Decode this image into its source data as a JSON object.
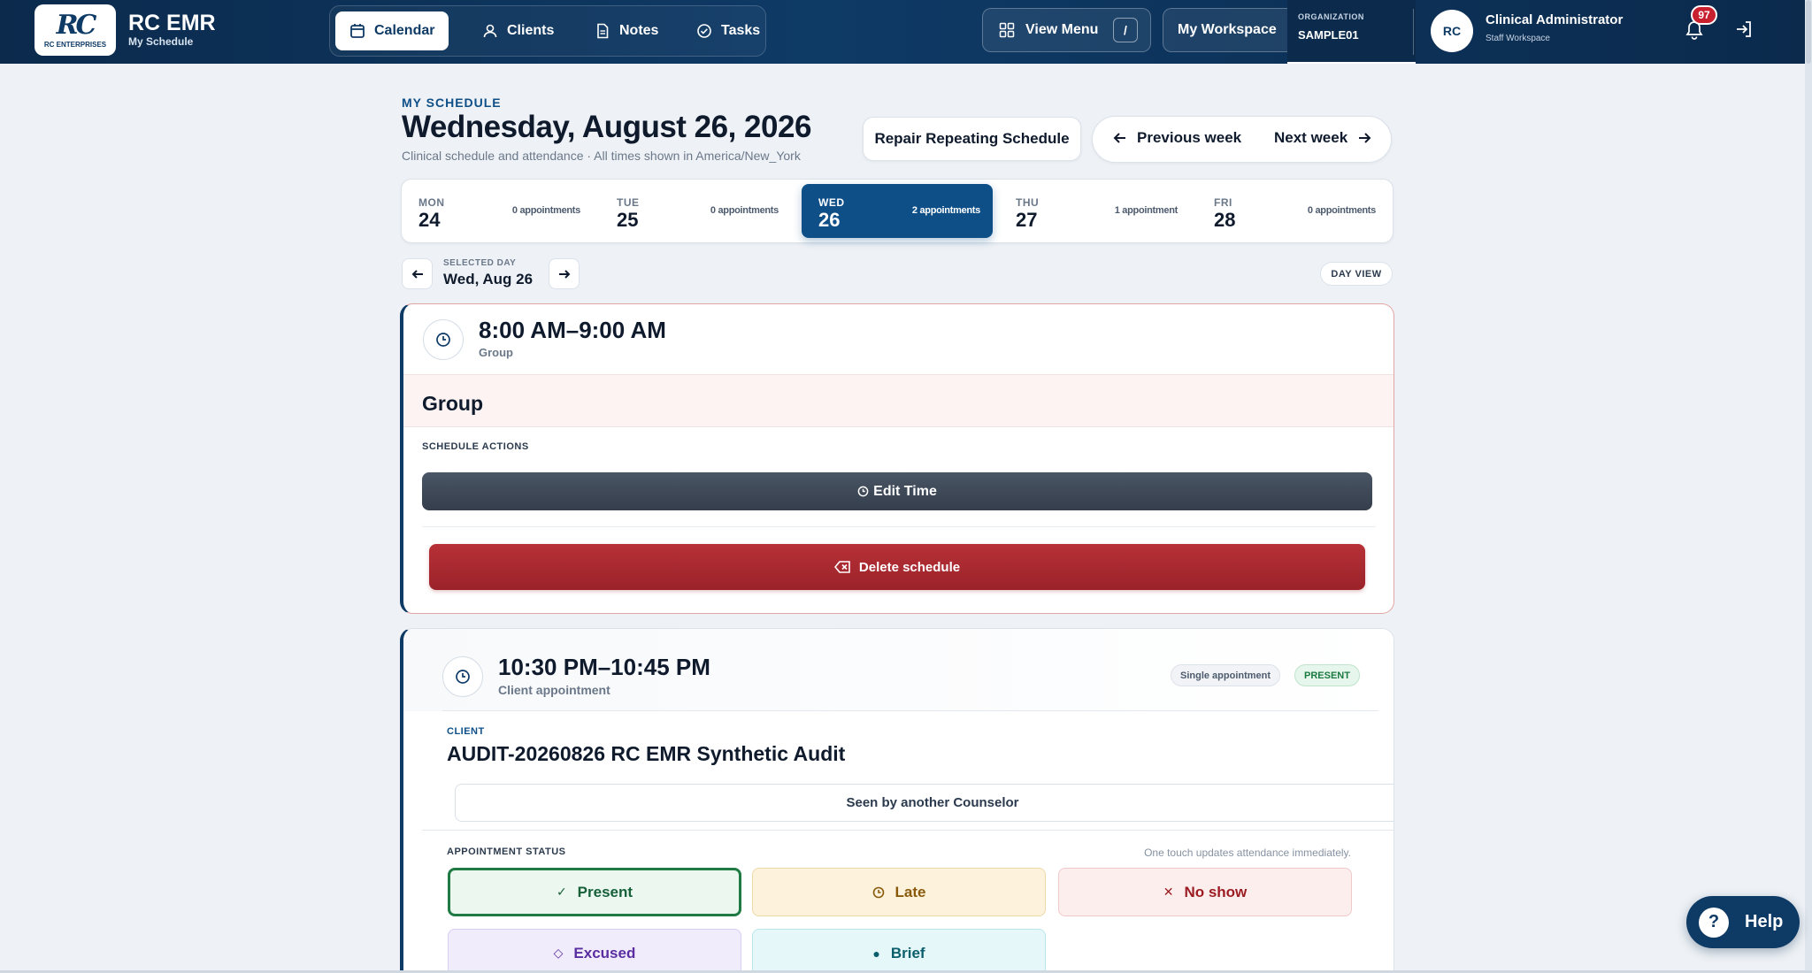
{
  "app": {
    "logo_mark": "RC",
    "logo_text": "RC ENTERPRISES",
    "title": "RC EMR",
    "subtitle": "My Schedule"
  },
  "nav": {
    "items": [
      {
        "label": "Calendar",
        "icon": "calendar-icon",
        "active": true
      },
      {
        "label": "Clients",
        "icon": "user-icon"
      },
      {
        "label": "Notes",
        "icon": "document-icon"
      },
      {
        "label": "Tasks",
        "icon": "check-circle-icon"
      }
    ]
  },
  "header": {
    "view_menu_label": "View Menu",
    "view_menu_shortcut": "/",
    "workspace_label": "My Workspace",
    "org_label": "ORGANIZATION",
    "org_value": "SAMPLE01",
    "avatar_initials": "RC",
    "user_name": "Clinical Administrator",
    "user_role": "Staff Workspace",
    "notification_count": "97"
  },
  "page": {
    "eyebrow": "MY SCHEDULE",
    "title": "Wednesday, August 26, 2026",
    "subtitle": "Clinical schedule and attendance · All times shown in America/New_York",
    "repair_label": "Repair Repeating Schedule",
    "prev_week_label": "Previous week",
    "next_week_label": "Next week"
  },
  "week": {
    "days": [
      {
        "name": "MON",
        "num": "24",
        "count": "0 appointments",
        "active": false
      },
      {
        "name": "TUE",
        "num": "25",
        "count": "0 appointments",
        "active": false
      },
      {
        "name": "WED",
        "num": "26",
        "count": "2 appointments",
        "active": true
      },
      {
        "name": "THU",
        "num": "27",
        "count": "1 appointment",
        "active": false
      },
      {
        "name": "FRI",
        "num": "28",
        "count": "0 appointments",
        "active": false
      }
    ]
  },
  "selector": {
    "label": "SELECTED DAY",
    "value": "Wed, Aug 26",
    "view_label": "DAY VIEW"
  },
  "card1": {
    "time": "8:00 AM–9:00 AM",
    "type": "Group",
    "name": "Group",
    "actions_label": "SCHEDULE ACTIONS",
    "edit_label": "Edit Time",
    "delete_label": "Delete schedule"
  },
  "card2": {
    "time": "10:30 PM–10:45 PM",
    "type": "Client appointment",
    "pill_single": "Single appointment",
    "pill_status": "PRESENT",
    "client_label": "CLIENT",
    "client_name": "AUDIT-20260826 RC EMR Synthetic Audit",
    "seen_label": "Seen by another Counselor",
    "status_label": "APPOINTMENT STATUS",
    "status_hint": "One touch updates attendance immediately.",
    "statuses": {
      "present": "Present",
      "late": "Late",
      "no_show": "No show",
      "excused": "Excused",
      "brief": "Brief"
    }
  },
  "help_label": "Help",
  "colors": {
    "navy": "#0e3a66",
    "accent_blue": "#0e4f88",
    "danger": "#9b222a",
    "present_green": "#1f7a44"
  }
}
